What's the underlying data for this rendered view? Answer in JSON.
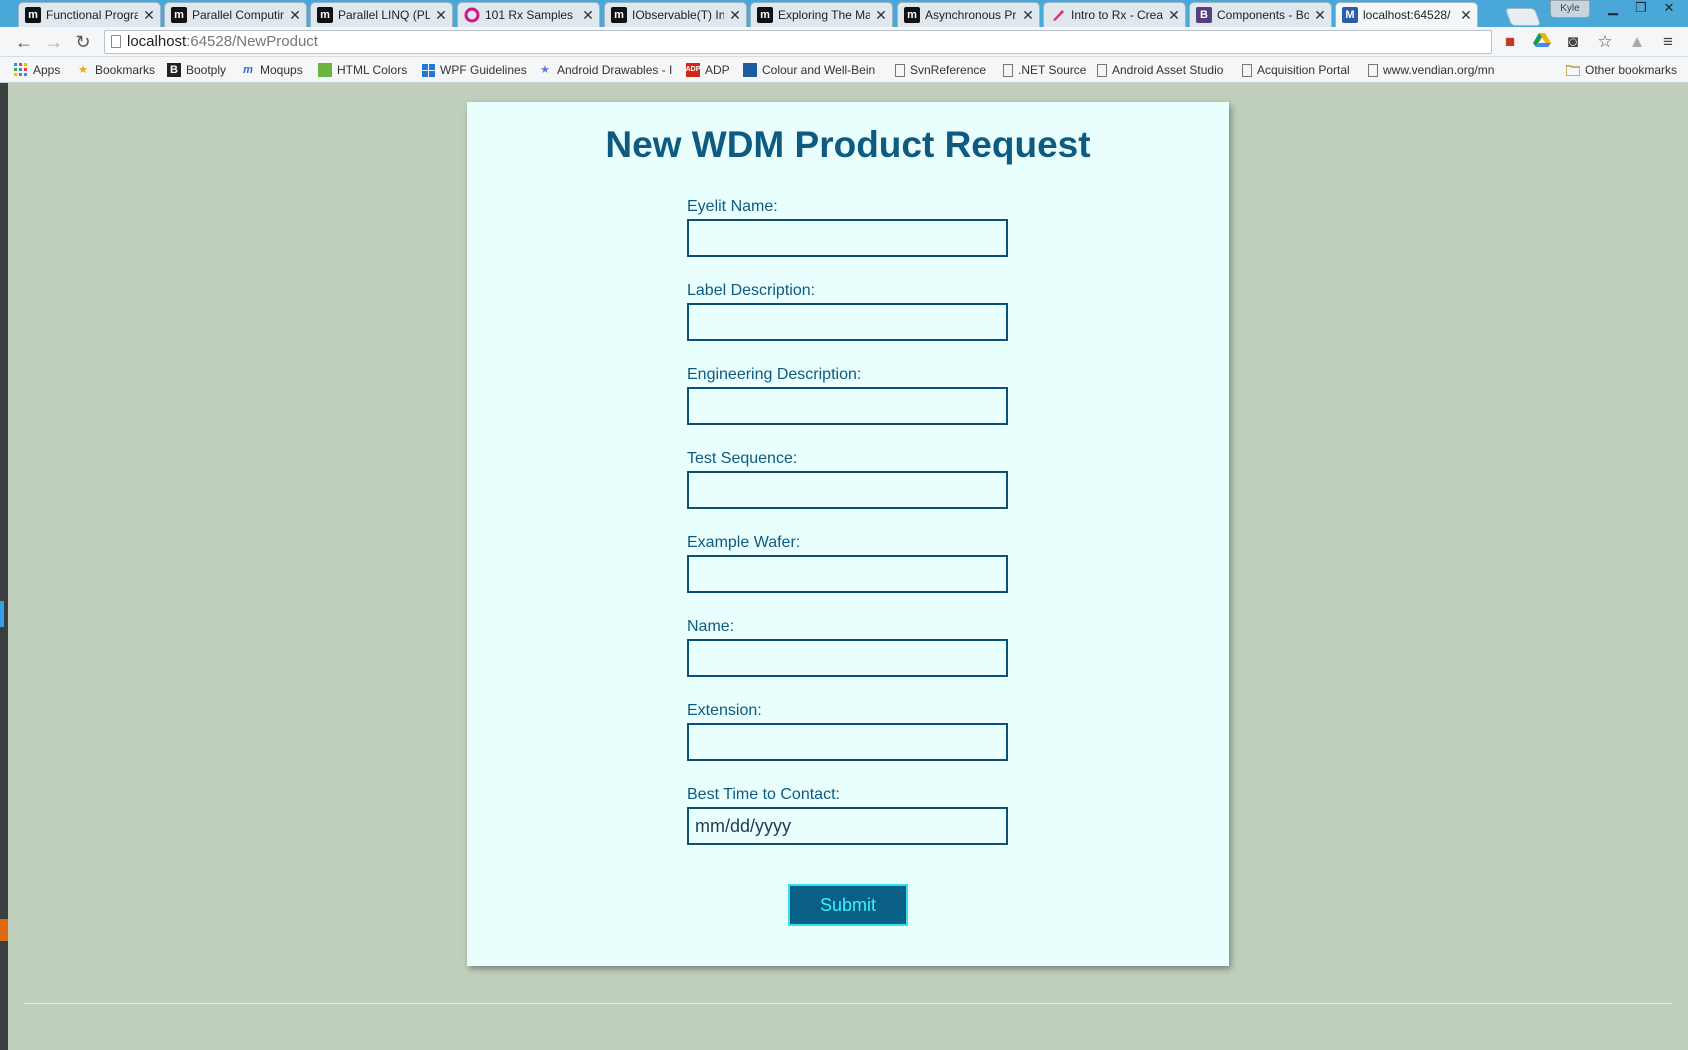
{
  "browser": {
    "tabs": [
      {
        "title": "Functional Progra",
        "favicon": "m"
      },
      {
        "title": "Parallel Computin",
        "favicon": "m"
      },
      {
        "title": "Parallel LINQ (PLI",
        "favicon": "m"
      },
      {
        "title": "101 Rx Samples -",
        "favicon": "rx-swirl"
      },
      {
        "title": "IObservable(T) In",
        "favicon": "m"
      },
      {
        "title": "Exploring The Ma",
        "favicon": "m"
      },
      {
        "title": "Asynchronous Pr",
        "favicon": "m"
      },
      {
        "title": "Intro to Rx - Crea",
        "favicon": "pen"
      },
      {
        "title": "Components - Bo",
        "favicon": "B"
      },
      {
        "title": "localhost:64528/",
        "favicon": "M"
      }
    ],
    "active_tab_index": 9,
    "profile_name": "Kyle",
    "url_host": "localhost",
    "url_path": ":64528/NewProduct",
    "bookmarks": [
      {
        "label": "Apps",
        "icon": "apps-grid-icon"
      },
      {
        "label": "Bookmarks",
        "icon": "star-icon"
      },
      {
        "label": "Bootply",
        "icon": "bootply-icon"
      },
      {
        "label": "Moqups",
        "icon": "moqups-icon"
      },
      {
        "label": "HTML Colors",
        "icon": "palette-icon"
      },
      {
        "label": "WPF Guidelines",
        "icon": "windows-icon"
      },
      {
        "label": "Android Drawables - I",
        "icon": "star-icon"
      },
      {
        "label": "ADP",
        "icon": "adp-icon"
      },
      {
        "label": "Colour and Well-Bein",
        "icon": "chart-icon"
      },
      {
        "label": "SvnReference",
        "icon": "page-icon"
      },
      {
        "label": ".NET Source",
        "icon": "page-icon"
      },
      {
        "label": "Android Asset Studio",
        "icon": "page-icon"
      },
      {
        "label": "Acquisition Portal",
        "icon": "page-icon"
      },
      {
        "label": "www.vendian.org/mn",
        "icon": "page-icon"
      }
    ],
    "other_bookmarks": "Other bookmarks"
  },
  "form": {
    "title": "New WDM Product Request",
    "fields": [
      {
        "label": "Eyelit Name:",
        "value": "",
        "placeholder": ""
      },
      {
        "label": "Label Description:",
        "value": "",
        "placeholder": ""
      },
      {
        "label": "Engineering Description:",
        "value": "",
        "placeholder": ""
      },
      {
        "label": "Test Sequence:",
        "value": "",
        "placeholder": ""
      },
      {
        "label": "Example Wafer:",
        "value": "",
        "placeholder": ""
      },
      {
        "label": "Name:",
        "value": "",
        "placeholder": ""
      },
      {
        "label": "Extension:",
        "value": "",
        "placeholder": ""
      },
      {
        "label": "Best Time to Contact:",
        "value": "",
        "placeholder": "mm/dd/yyyy"
      }
    ],
    "submit_label": "Submit"
  },
  "colors": {
    "page_background": "#bfcfbb",
    "card_background": "#e8fffe",
    "title_text": "#0e5a80",
    "input_border": "#0d4f72",
    "submit_background": "#0a5f86",
    "submit_text": "#3ff0ff"
  }
}
